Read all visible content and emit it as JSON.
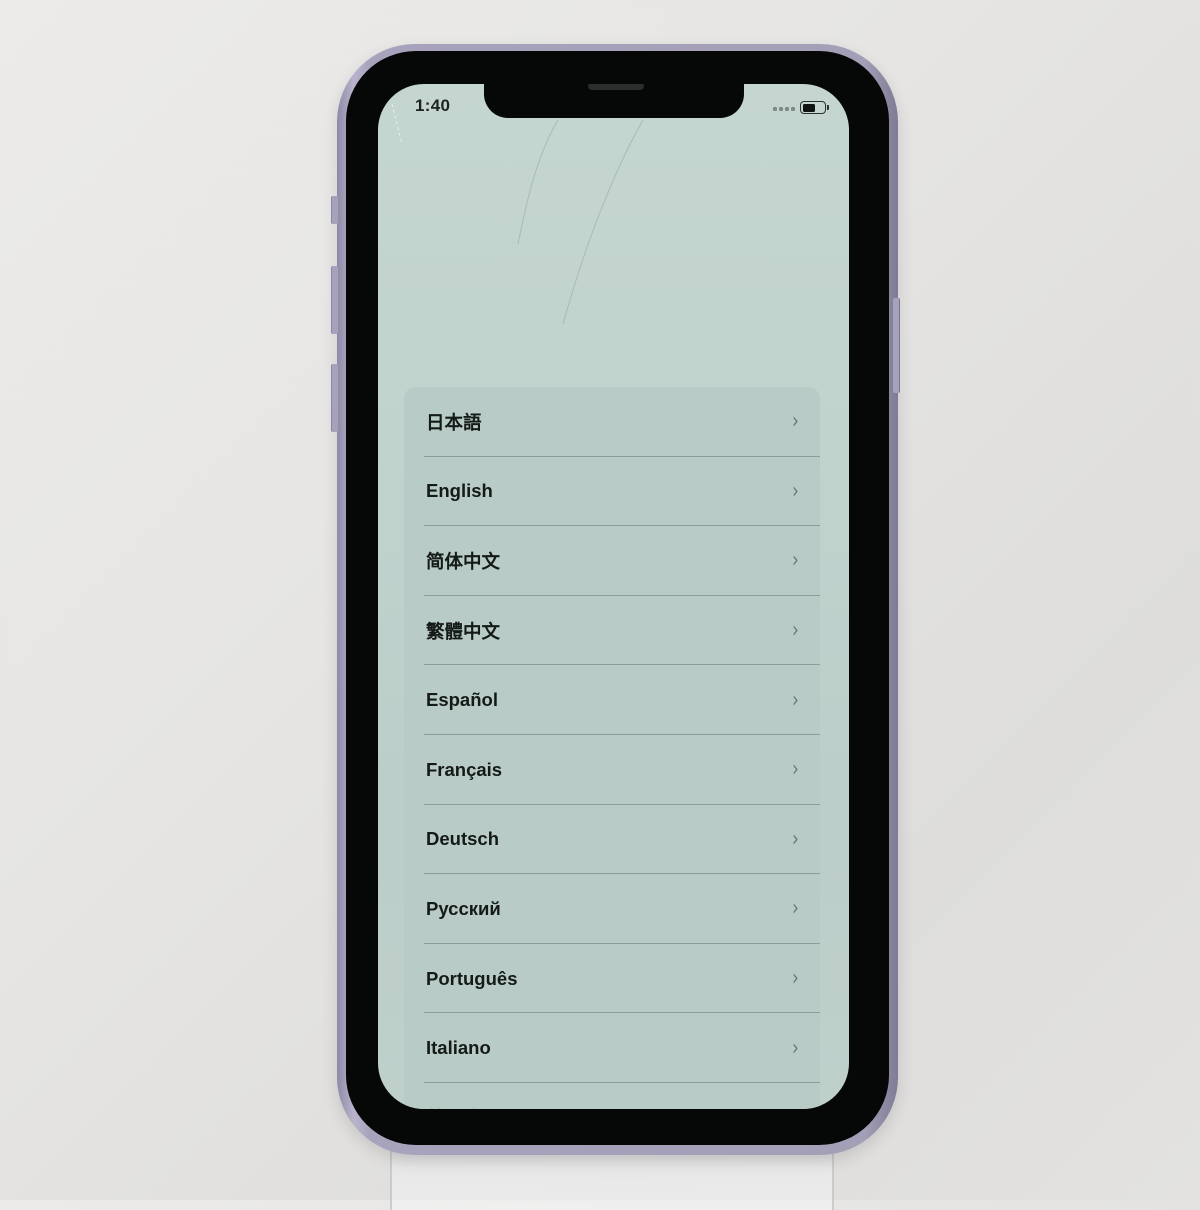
{
  "status_bar": {
    "time": "1:40",
    "signal_icon": "signal-dots-icon",
    "battery_icon": "battery-icon",
    "battery_level_fraction": 0.6
  },
  "language_list": {
    "items": [
      {
        "label": "日本語",
        "icon": "chevron-right-icon"
      },
      {
        "label": "English",
        "icon": "chevron-right-icon"
      },
      {
        "label": "简体中文",
        "icon": "chevron-right-icon"
      },
      {
        "label": "繁體中文",
        "icon": "chevron-right-icon"
      },
      {
        "label": "Español",
        "icon": "chevron-right-icon"
      },
      {
        "label": "Français",
        "icon": "chevron-right-icon"
      },
      {
        "label": "Deutsch",
        "icon": "chevron-right-icon"
      },
      {
        "label": "Русский",
        "icon": "chevron-right-icon"
      },
      {
        "label": "Português",
        "icon": "chevron-right-icon"
      },
      {
        "label": "Italiano",
        "icon": "chevron-right-icon"
      },
      {
        "label": "한국어",
        "icon": "chevron-right-icon"
      }
    ],
    "chevron_glyph": "›"
  },
  "colors": {
    "screen_bg": "#c3d4ce",
    "list_bg": "#b9cbc6",
    "text": "#141a18",
    "phone_frame": "#a8a3bd"
  }
}
